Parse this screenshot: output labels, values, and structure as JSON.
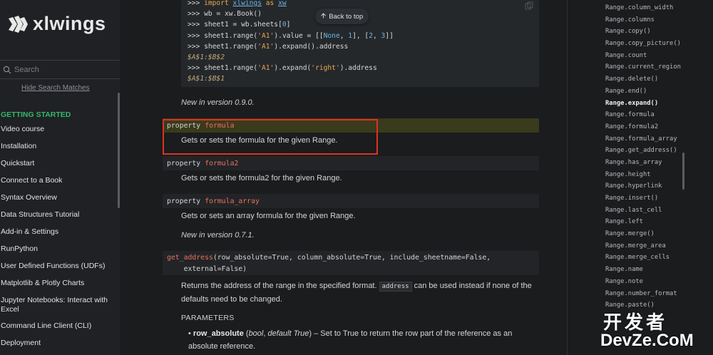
{
  "sidebar": {
    "brand": "xlwings",
    "search_placeholder": "Search",
    "hide_matches": "Hide Search Matches",
    "caption": "GETTING STARTED",
    "items": [
      "Video course",
      "Installation",
      "Quickstart",
      "Connect to a Book",
      "Syntax Overview",
      "Data Structures Tutorial",
      "Add-in & Settings",
      "RunPython",
      "User Defined Functions (UDFs)",
      "Matplotlib & Plotly Charts",
      "Jupyter Notebooks: Interact with Excel",
      "Command Line Client (CLI)",
      "Deployment"
    ]
  },
  "main": {
    "back_to_top": "Back to top",
    "code": {
      "l1_prompt": ">>> ",
      "l1_kw": "import",
      "l1_mod": "xlwings",
      "l1_as": "as",
      "l1_alias": "xw",
      "l2": ">>> wb = xw.Book()",
      "l3_a": ">>> sheet1 = wb.sheets[",
      "l3_n": "0",
      "l3_b": "]",
      "l4_a": ">>> sheet1.range(",
      "l4_s": "'A1'",
      "l4_b": ").value = [[",
      "l4_none": "None",
      "l4_c": ", ",
      "l4_n1": "1",
      "l4_d": "], [",
      "l4_n2": "2",
      "l4_e": ", ",
      "l4_n3": "3",
      "l4_f": "]]",
      "l5_a": ">>> sheet1.range(",
      "l5_s": "'A1'",
      "l5_b": ").expand().address",
      "l6": "$A$1:$B$2",
      "l7_a": ">>> sheet1.range(",
      "l7_s": "'A1'",
      "l7_b": ").expand(",
      "l7_s2": "'right'",
      "l7_c": ").address",
      "l8": "$A$1:$B$1"
    },
    "version_1": "New in version 0.9.0.",
    "properties": [
      {
        "keyword": "property",
        "name": "formula",
        "desc": "Gets or sets the formula for the given Range."
      },
      {
        "keyword": "property",
        "name": "formula2",
        "desc": "Gets or sets the formula2 for the given Range."
      },
      {
        "keyword": "property",
        "name": "formula_array",
        "desc": "Gets or sets an array formula for the given Range."
      }
    ],
    "version_2": "New in version 0.7.1.",
    "get_address": {
      "name": "get_address",
      "sig1": "(row_absolute=True, column_absolute=True, include_sheetname=False,",
      "sig2": "    external=False)",
      "desc_a": "Returns the address of the range in the specified format.",
      "desc_code": "address",
      "desc_b": "can be used instead if none of the defaults need to be changed.",
      "params_label": "PARAMETERS",
      "param_name": "row_absolute",
      "param_type": "(bool, default True)",
      "param_desc": "– Set to True to return the row part of the reference as an absolute reference."
    }
  },
  "toc": [
    "Range.column_width",
    "Range.columns",
    "Range.copy()",
    "Range.copy_picture()",
    "Range.count",
    "Range.current_region",
    "Range.delete()",
    "Range.end()",
    "Range.expand()",
    "Range.formula",
    "Range.formula2",
    "Range.formula_array",
    "Range.get_address()",
    "Range.has_array",
    "Range.height",
    "Range.hyperlink",
    "Range.insert()",
    "Range.last_cell",
    "Range.left",
    "Range.merge()",
    "Range.merge_area",
    "Range.merge_cells",
    "Range.name",
    "Range.note",
    "Range.number_format",
    "Range.paste()"
  ],
  "toc_active": "Range.expand()",
  "watermark": {
    "line1": "开发者",
    "line2": "DevZe.CoM"
  },
  "colors": {
    "accent_green": "#34b86a",
    "highlight_red": "#e0321f",
    "name_red": "#e9715f"
  }
}
